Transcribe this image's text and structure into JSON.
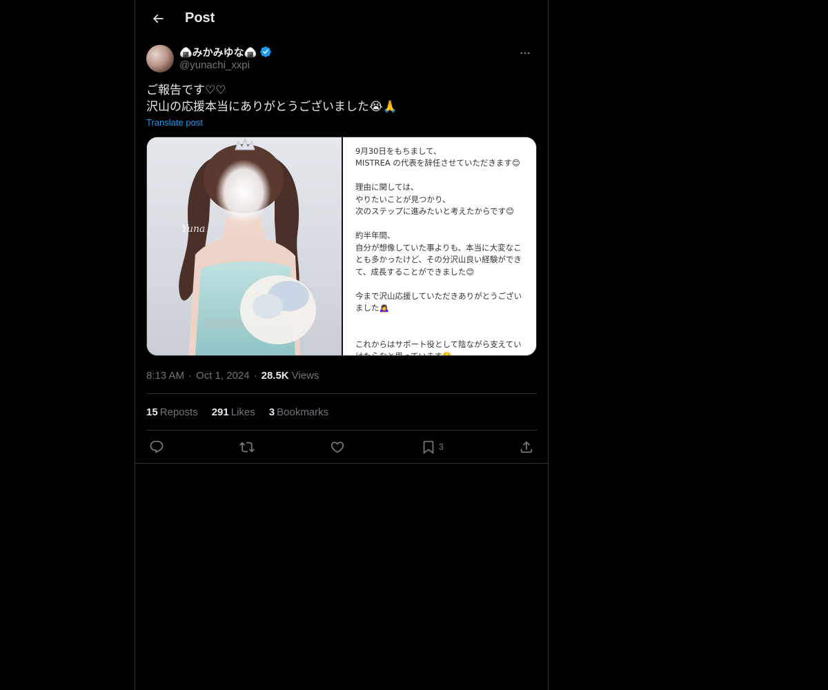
{
  "header": {
    "title": "Post"
  },
  "author": {
    "display_name": "🍙みかみゆな🍙",
    "handle": "@yunachi_xxpi",
    "verified": true
  },
  "post": {
    "text": "ご報告です♡♡\n沢山の応援本当にありがとうございました😭🙏",
    "translate_label": "Translate post",
    "time": "8:13 AM",
    "date": "Oct 1, 2024",
    "views_count": "28.5K",
    "views_label": "Views"
  },
  "media": {
    "watermark": "Yuna",
    "notice_text": "9月30日をもちまして、\nMISTREA の代表を辞任させていただきます😊\n\n理由に関しては、\nやりたいことが見つかり、\n次のステップに進みたいと考えたからです😊\n\n約半年間、\n自分が想像していた事よりも、本当に大変なこ\nとも多かったけど、その分沢山良い経験ができ\nて、成長することができました😊\n\n今まで沢山応援していただきありがとうござい\nました🙇‍♀️\n\n\nこれからはサポート役として陰ながら支えてい\nけたらなと思っています☺️"
  },
  "stats": {
    "reposts_count": "15",
    "reposts_label": "Reposts",
    "likes_count": "291",
    "likes_label": "Likes",
    "bookmarks_count": "3",
    "bookmarks_label": "Bookmarks"
  },
  "actions": {
    "bookmark_count": "3"
  },
  "colors": {
    "background": "#000000",
    "accent": "#1d9bf0",
    "muted": "#71767b",
    "border": "#2f3336"
  }
}
